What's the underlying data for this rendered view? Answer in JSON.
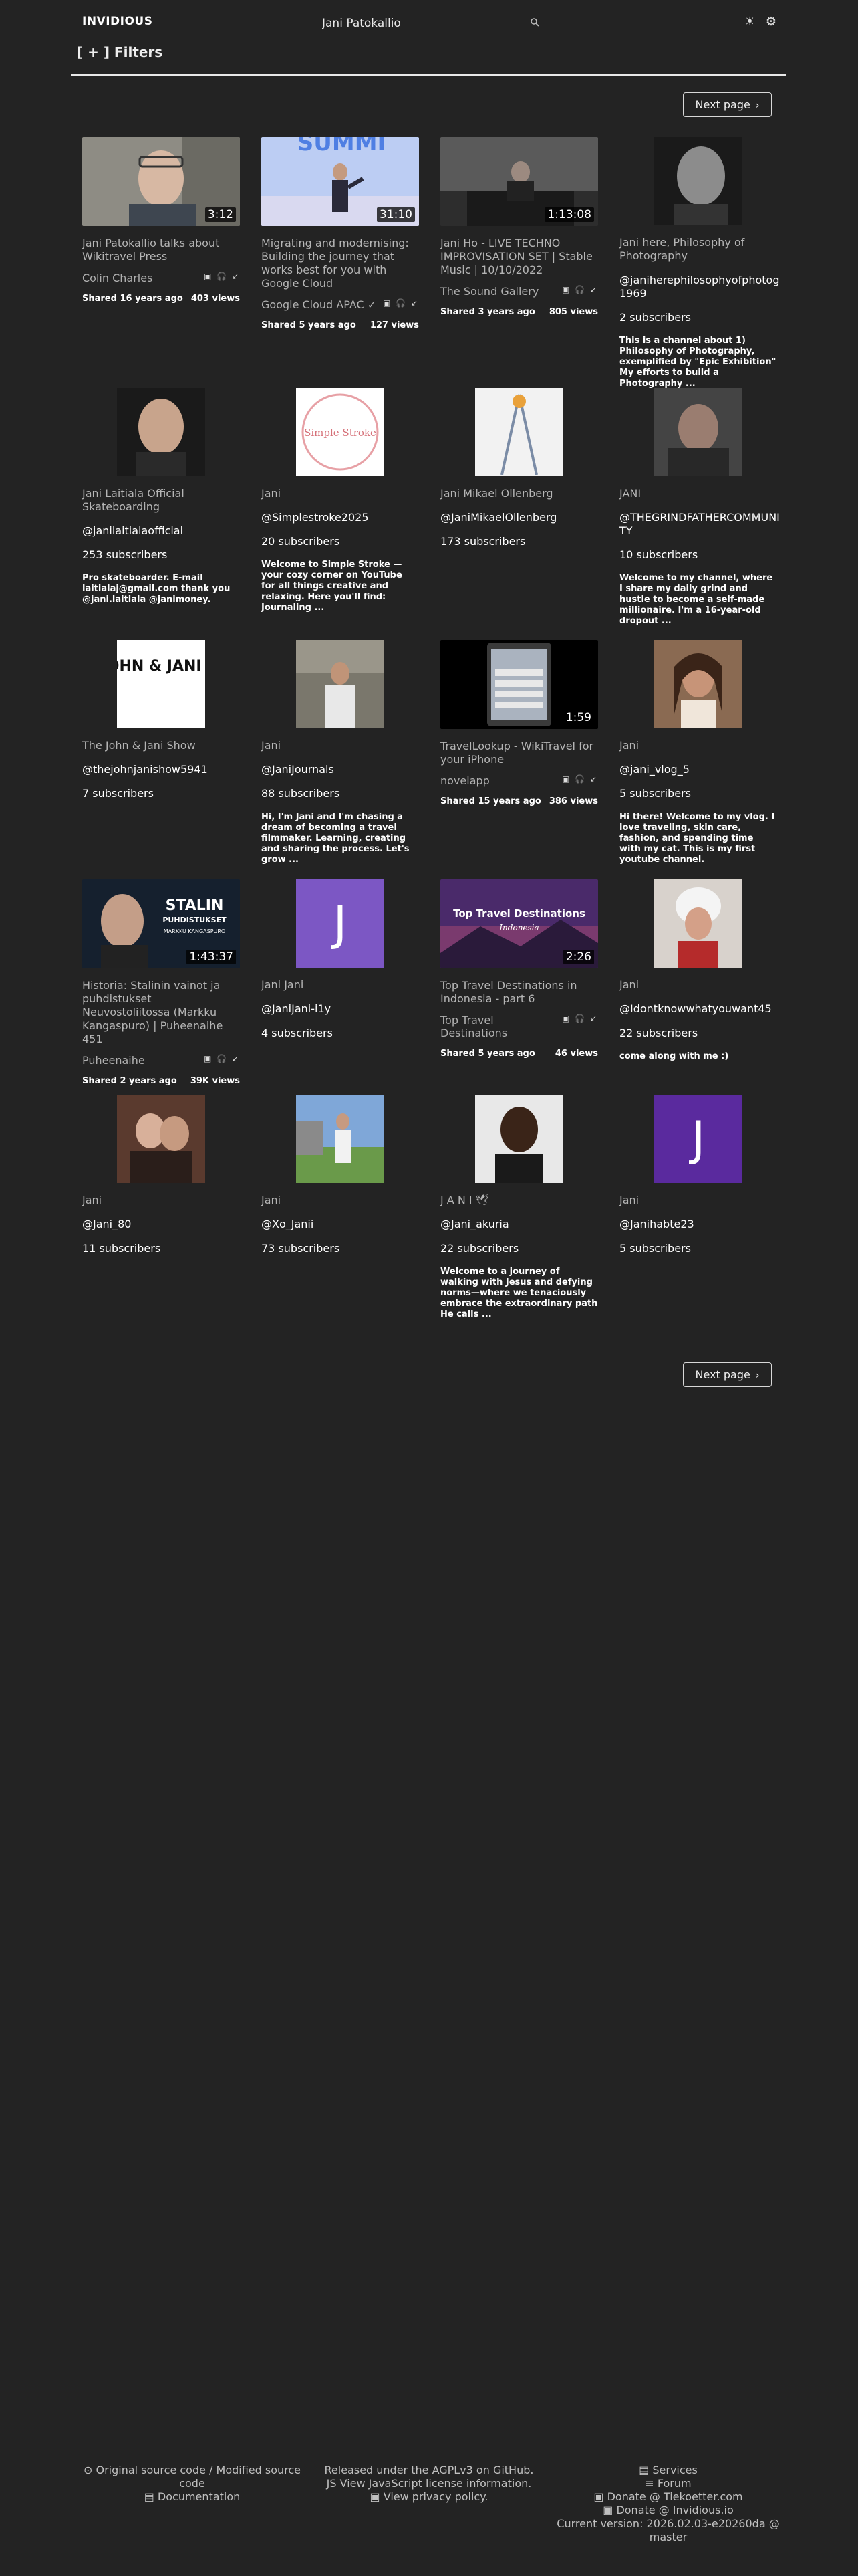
{
  "app": {
    "brand": "INVIDIOUS"
  },
  "search": {
    "value": "Jani Patokallio",
    "icon": "search-icon"
  },
  "theme": {
    "sun": "☀",
    "gear": "⚙"
  },
  "filters": {
    "label": "[ + ]  Filters"
  },
  "pagination": {
    "next_label": "Next page"
  },
  "rows": [
    [
      {
        "kind": "video",
        "title": "Jani Patokallio talks about Wikitravel Press",
        "channel": "Colin Charles",
        "icons": "▣ 🎧 ↙",
        "shared": "Shared 16 years ago",
        "views": "403 views",
        "duration": "3:12"
      },
      {
        "kind": "video",
        "title": "Migrating and modernising: Building the journey that works best for you with Google Cloud",
        "channel": "Google Cloud APAC ✓",
        "icons": "▣ 🎧 ↙",
        "shared": "Shared 5 years ago",
        "views": "127 views",
        "duration": "31:10",
        "thumb_text": "SUMMI"
      },
      {
        "kind": "video",
        "title": "Jani Ho - LIVE TECHNO IMPROVISATION SET | Stable Music | 10/10/2022",
        "channel": "The Sound Gallery",
        "icons": "▣ 🎧 ↙",
        "shared": "Shared 3 years ago",
        "views": "805 views",
        "duration": "1:13:08"
      },
      {
        "kind": "channel",
        "name": "Jani here, Philosophy of Photography",
        "handle": "@janiherephilosophyofphotog1969",
        "subs": "2 subscribers",
        "desc": "This is a channel about 1) Philosophy of Photography, exemplified by \"Epic Exhibition\" My efforts to build a Photography ..."
      }
    ],
    [
      {
        "kind": "channel",
        "name": "Jani Laitiala Official Skateboarding",
        "handle": "@janilaitialaofficial",
        "subs": "253 subscribers",
        "desc": "Pro skateboarder. E-mail laitialaj@gmail.com thank you @jani.laitiala @janimoney."
      },
      {
        "kind": "channel",
        "name": "Jani",
        "handle": "@Simplestroke2025",
        "subs": "20 subscribers",
        "desc": "Welcome to Simple Stroke — your cozy corner on YouTube for all things creative and relaxing. Here you'll find: Journaling ...",
        "thumb_text": "Simple Stroke"
      },
      {
        "kind": "channel",
        "name": "Jani Mikael Ollenberg",
        "handle": "@JaniMikaelOllenberg",
        "subs": "173 subscribers",
        "desc": ""
      },
      {
        "kind": "channel",
        "name": "JANI",
        "handle": "@THEGRINDFATHERCOMMUNITY",
        "subs": "10 subscribers",
        "desc": "Welcome to my channel, where I share my daily grind and hustle to become a self-made millionaire. I'm a 16-year-old dropout ..."
      }
    ],
    [
      {
        "kind": "channel",
        "name": "The John & Jani Show",
        "handle": "@thejohnjanishow5941",
        "subs": "7 subscribers",
        "desc": "",
        "thumb_text": "THE JOHN & JANI SHOW"
      },
      {
        "kind": "channel",
        "name": "Jani",
        "handle": "@JaniJournals",
        "subs": "88 subscribers",
        "desc": "Hi, I'm Jani and I'm chasing a dream of becoming a travel filmmaker. Learning, creating and sharing the process. Let's grow ..."
      },
      {
        "kind": "video",
        "title": "TravelLookup - WikiTravel for your iPhone",
        "channel": "novelapp",
        "icons": "▣ 🎧 ↙",
        "shared": "Shared 15 years ago",
        "views": "386 views",
        "duration": "1:59"
      },
      {
        "kind": "channel",
        "name": "Jani",
        "handle": "@jani_vlog_5",
        "subs": "5 subscribers",
        "desc": "Hi there! Welcome to my vlog. I love traveling, skin care, fashion, and spending time with my cat. This is my first youtube channel."
      }
    ],
    [
      {
        "kind": "video",
        "title": "Historia: Stalinin vainot ja puhdistukset Neuvostoliitossa (Markku Kangaspuro) | Puheenaihe 451",
        "channel": "Puheenaihe",
        "icons": "▣ 🎧 ↙",
        "shared": "Shared 2 years ago",
        "views": "39K views",
        "duration": "1:43:37",
        "thumb_text": "STALIN",
        "thumb_text2": "PUHDISTUKSET",
        "thumb_text3": "MARKKU KANGASPURO"
      },
      {
        "kind": "channel",
        "name": "Jani Jani",
        "handle": "@JaniJani-i1y",
        "subs": "4 subscribers",
        "desc": "",
        "letter": "J"
      },
      {
        "kind": "video",
        "title": "Top Travel Destinations in Indonesia - part 6",
        "channel": "Top Travel Destinations",
        "icons": "▣ 🎧 ↙",
        "shared": "Shared 5 years ago",
        "views": "46 views",
        "duration": "2:26",
        "thumb_text": "Top Travel Destinations",
        "thumb_text2": "Indonesia"
      },
      {
        "kind": "channel",
        "name": "Jani",
        "handle": "@Idontknowwhatyouwant45",
        "subs": "22 subscribers",
        "desc": "come along with me :)"
      }
    ],
    [
      {
        "kind": "channel",
        "name": "Jani",
        "handle": "@Jani_80",
        "subs": "11 subscribers",
        "desc": ""
      },
      {
        "kind": "channel",
        "name": "Jani",
        "handle": "@Xo_Janii",
        "subs": "73 subscribers",
        "desc": ""
      },
      {
        "kind": "channel",
        "name": "J A N I 🕊",
        "handle": "@Jani_akuria",
        "subs": "22 subscribers",
        "desc": "Welcome to a journey of walking with Jesus and defying norms—where we tenaciously embrace the extraordinary path He calls ..."
      },
      {
        "kind": "channel",
        "name": "Jani",
        "handle": "@Janihabte23",
        "subs": "5 subscribers",
        "desc": "",
        "letter": "J"
      }
    ]
  ],
  "footer": {
    "left": [
      "Original source code / Modified source code",
      "Documentation"
    ],
    "middle": [
      "Released under the AGPLv3 on GitHub.",
      "View JavaScript license information.",
      "View privacy policy."
    ],
    "right": [
      "Services",
      "Forum",
      "Donate @ Tiekoetter.com",
      "Donate @ Invidious.io",
      "Current version: 2026.02.03-e20260da @ master"
    ]
  }
}
